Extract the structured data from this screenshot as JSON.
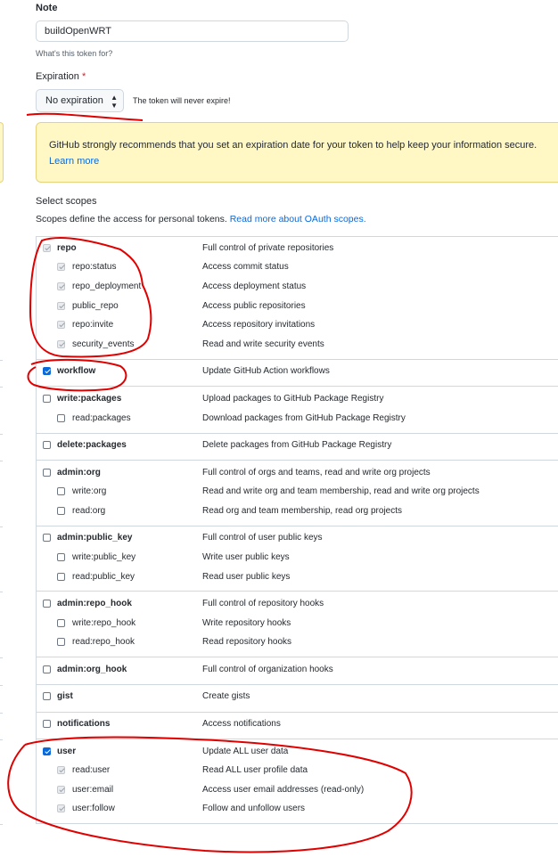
{
  "note": {
    "label": "Note",
    "value": "buildOpenWRT",
    "hint": "What's this token for?"
  },
  "expiration": {
    "label": "Expiration",
    "required_mark": "*",
    "selected": "No expiration",
    "arrow_icon": "chevron-updown-icon",
    "hint": "The token will never expire!"
  },
  "flash": {
    "text": "GitHub strongly recommends that you set an expiration date for your token to help keep your information secure.",
    "link": "Learn more"
  },
  "scopes": {
    "title": "Select scopes",
    "desc": "Scopes define the access for personal tokens. ",
    "desc_link": "Read more about OAuth scopes."
  },
  "scope_rows": [
    {
      "name": "repo",
      "desc": "Full control of private repositories",
      "parent": true,
      "state": "disabled"
    },
    {
      "name": "repo:status",
      "desc": "Access commit status",
      "parent": false,
      "state": "disabled"
    },
    {
      "name": "repo_deployment",
      "desc": "Access deployment status",
      "parent": false,
      "state": "disabled"
    },
    {
      "name": "public_repo",
      "desc": "Access public repositories",
      "parent": false,
      "state": "disabled"
    },
    {
      "name": "repo:invite",
      "desc": "Access repository invitations",
      "parent": false,
      "state": "disabled"
    },
    {
      "name": "security_events",
      "desc": "Read and write security events",
      "parent": false,
      "state": "disabled"
    },
    {
      "name": "workflow",
      "desc": "Update GitHub Action workflows",
      "parent": true,
      "state": "checked"
    },
    {
      "name": "write:packages",
      "desc": "Upload packages to GitHub Package Registry",
      "parent": true,
      "state": "unchecked"
    },
    {
      "name": "read:packages",
      "desc": "Download packages from GitHub Package Registry",
      "parent": false,
      "state": "unchecked"
    },
    {
      "name": "delete:packages",
      "desc": "Delete packages from GitHub Package Registry",
      "parent": true,
      "state": "unchecked"
    },
    {
      "name": "admin:org",
      "desc": "Full control of orgs and teams, read and write org projects",
      "parent": true,
      "state": "unchecked"
    },
    {
      "name": "write:org",
      "desc": "Read and write org and team membership, read and write org projects",
      "parent": false,
      "state": "unchecked"
    },
    {
      "name": "read:org",
      "desc": "Read org and team membership, read org projects",
      "parent": false,
      "state": "unchecked"
    },
    {
      "name": "admin:public_key",
      "desc": "Full control of user public keys",
      "parent": true,
      "state": "unchecked"
    },
    {
      "name": "write:public_key",
      "desc": "Write user public keys",
      "parent": false,
      "state": "unchecked"
    },
    {
      "name": "read:public_key",
      "desc": "Read user public keys",
      "parent": false,
      "state": "unchecked"
    },
    {
      "name": "admin:repo_hook",
      "desc": "Full control of repository hooks",
      "parent": true,
      "state": "unchecked"
    },
    {
      "name": "write:repo_hook",
      "desc": "Write repository hooks",
      "parent": false,
      "state": "unchecked"
    },
    {
      "name": "read:repo_hook",
      "desc": "Read repository hooks",
      "parent": false,
      "state": "unchecked"
    },
    {
      "name": "admin:org_hook",
      "desc": "Full control of organization hooks",
      "parent": true,
      "state": "unchecked"
    },
    {
      "name": "gist",
      "desc": "Create gists",
      "parent": true,
      "state": "unchecked"
    },
    {
      "name": "notifications",
      "desc": "Access notifications",
      "parent": true,
      "state": "unchecked"
    },
    {
      "name": "user",
      "desc": "Update ALL user data",
      "parent": true,
      "state": "checked"
    },
    {
      "name": "read:user",
      "desc": "Read ALL user profile data",
      "parent": false,
      "state": "disabled"
    },
    {
      "name": "user:email",
      "desc": "Access user email addresses (read-only)",
      "parent": false,
      "state": "disabled"
    },
    {
      "name": "user:follow",
      "desc": "Follow and unfollow users",
      "parent": false,
      "state": "disabled"
    }
  ],
  "colors": {
    "accent": "#0969da",
    "flash_bg": "#fff8c5",
    "annotation": "#e00000"
  }
}
